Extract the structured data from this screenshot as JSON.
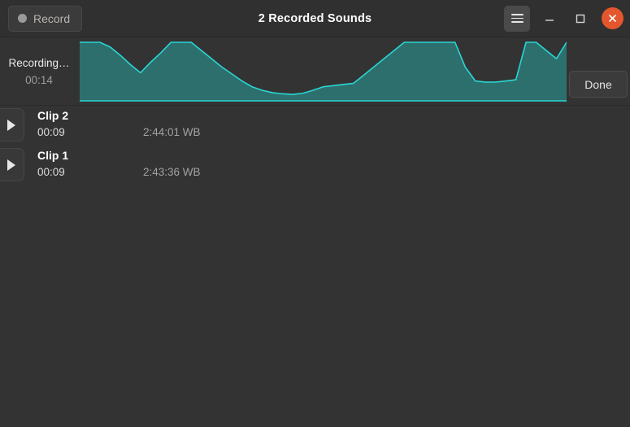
{
  "window": {
    "title": "2 Recorded Sounds",
    "record_button_label": "Record",
    "menu_icon": "hamburger-icon",
    "minimize_icon": "minimize-icon",
    "maximize_icon": "maximize-icon",
    "close_icon": "close-icon",
    "accent_close_color": "#e4572e",
    "background_color": "#333333",
    "titlebar_color": "#303030"
  },
  "recording": {
    "status": "Recording…",
    "timer": "00:14",
    "done_label": "Done",
    "wave_stroke_color": "#2ad6d6",
    "wave_fill_color": "#2d6f6c"
  },
  "chart_data": {
    "type": "area",
    "title": "",
    "xlabel": "",
    "ylabel": "",
    "ylim": [
      0,
      100
    ],
    "x": [
      0,
      1,
      2,
      3,
      4,
      5,
      6,
      7,
      8,
      9,
      10,
      11,
      12,
      13,
      14,
      15,
      16,
      17,
      18,
      19,
      20,
      21,
      22,
      23,
      24,
      25,
      26,
      27,
      28,
      29,
      30,
      31,
      32,
      33,
      34,
      35,
      36,
      37,
      38,
      39,
      40,
      41,
      42,
      43,
      44,
      45,
      46,
      47,
      48
    ],
    "values": [
      100,
      100,
      100,
      92,
      78,
      62,
      48,
      66,
      82,
      100,
      100,
      100,
      86,
      72,
      58,
      46,
      34,
      24,
      18,
      14,
      12,
      11,
      13,
      18,
      24,
      26,
      28,
      30,
      44,
      58,
      72,
      86,
      100,
      100,
      100,
      100,
      100,
      100,
      58,
      34,
      32,
      32,
      34,
      36,
      100,
      100,
      86,
      72,
      100
    ],
    "grid": false,
    "legend": null
  },
  "clips": {
    "items": [
      {
        "name": "Clip 2",
        "duration": "00:09",
        "timestamp": "2:44:01 WB",
        "play_icon": "play-icon"
      },
      {
        "name": "Clip 1",
        "duration": "00:09",
        "timestamp": "2:43:36 WB",
        "play_icon": "play-icon"
      }
    ]
  }
}
